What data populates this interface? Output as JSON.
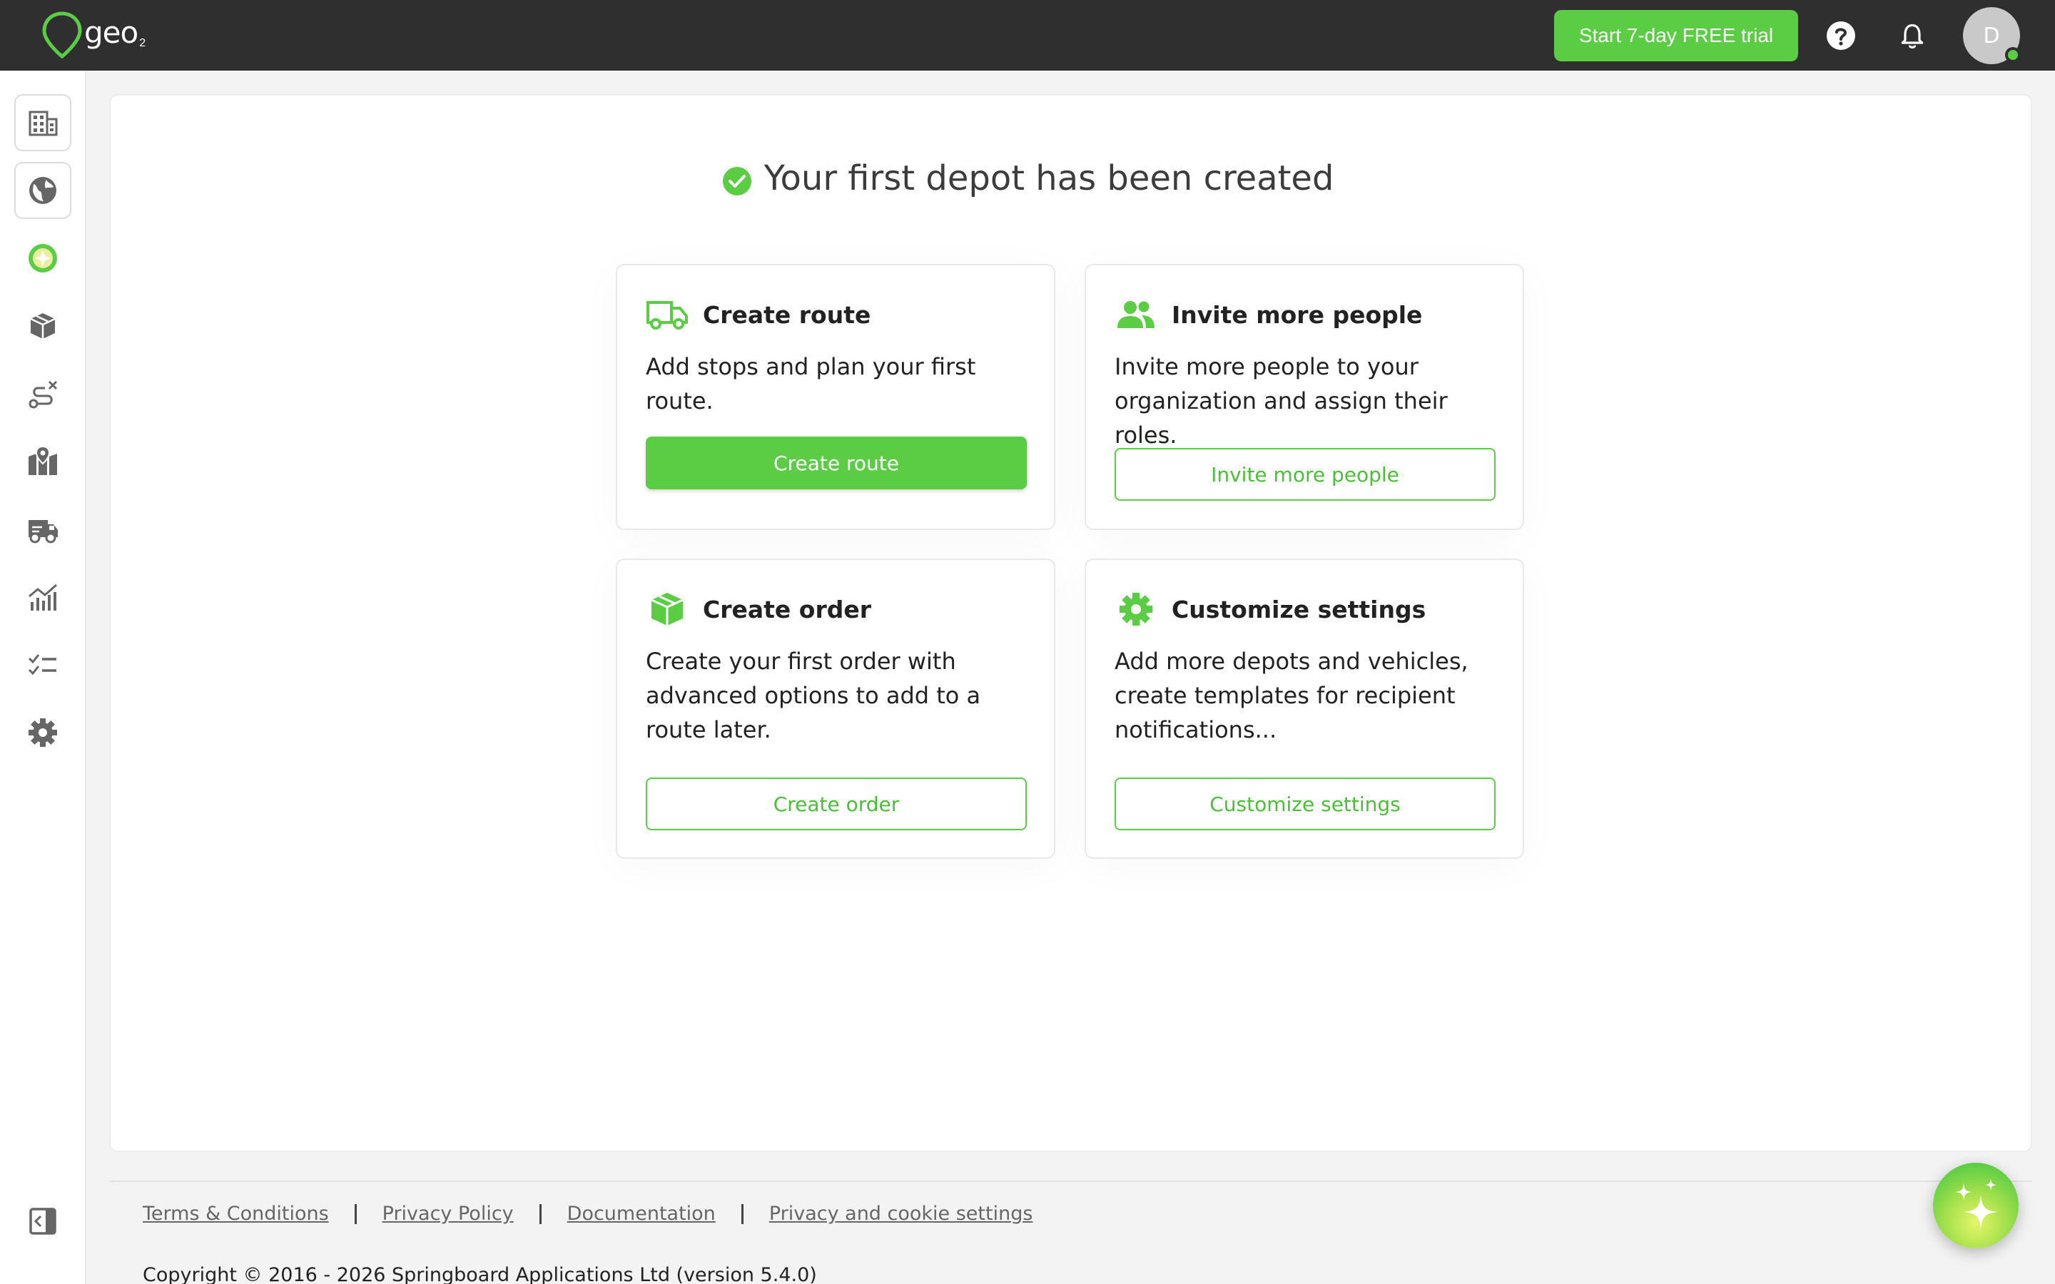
{
  "brand": {
    "name": "geo",
    "sub": "2"
  },
  "header": {
    "trial_button": "Start 7-day FREE trial",
    "avatar_initial": "D"
  },
  "sidebar": {
    "items": [
      {
        "icon": "building-icon",
        "boxed": true
      },
      {
        "icon": "globe-icon",
        "boxed": true
      },
      {
        "icon": "world-color-icon",
        "boxed": false
      },
      {
        "icon": "package-icon",
        "boxed": false
      },
      {
        "icon": "route-icon",
        "boxed": false
      },
      {
        "icon": "map-pin-icon",
        "boxed": false
      },
      {
        "icon": "vehicle-icon",
        "boxed": false
      },
      {
        "icon": "analytics-icon",
        "boxed": false
      },
      {
        "icon": "checklist-icon",
        "boxed": false
      },
      {
        "icon": "gear-icon",
        "boxed": false
      }
    ],
    "collapse_icon": "collapse-sidebar-icon"
  },
  "main": {
    "heading": "Your first depot has been created",
    "cards": [
      {
        "icon": "truck-icon",
        "title": "Create route",
        "description": "Add stops and plan your first route.",
        "button": "Create route",
        "button_style": "primary"
      },
      {
        "icon": "people-icon",
        "title": "Invite more people",
        "description": "Invite more people to your organization and assign their roles.",
        "button": "Invite more people",
        "button_style": "outline"
      },
      {
        "icon": "box-icon",
        "title": "Create order",
        "description": "Create your first order with advanced options to add to a route later.",
        "button": "Create order",
        "button_style": "outline"
      },
      {
        "icon": "gear-icon",
        "title": "Customize settings",
        "description": "Add more depots and vehicles, create templates for recipient notifications...",
        "button": "Customize settings",
        "button_style": "outline"
      }
    ]
  },
  "footer": {
    "links": [
      "Terms & Conditions",
      "Privacy Policy",
      "Documentation",
      "Privacy and cookie settings"
    ],
    "copyright": "Copyright © 2016 - 2026 Springboard Applications Ltd (version 5.4.0)"
  },
  "colors": {
    "accent": "#5bcd45",
    "topbar": "#2f2f2f",
    "background": "#f3f3f3"
  }
}
